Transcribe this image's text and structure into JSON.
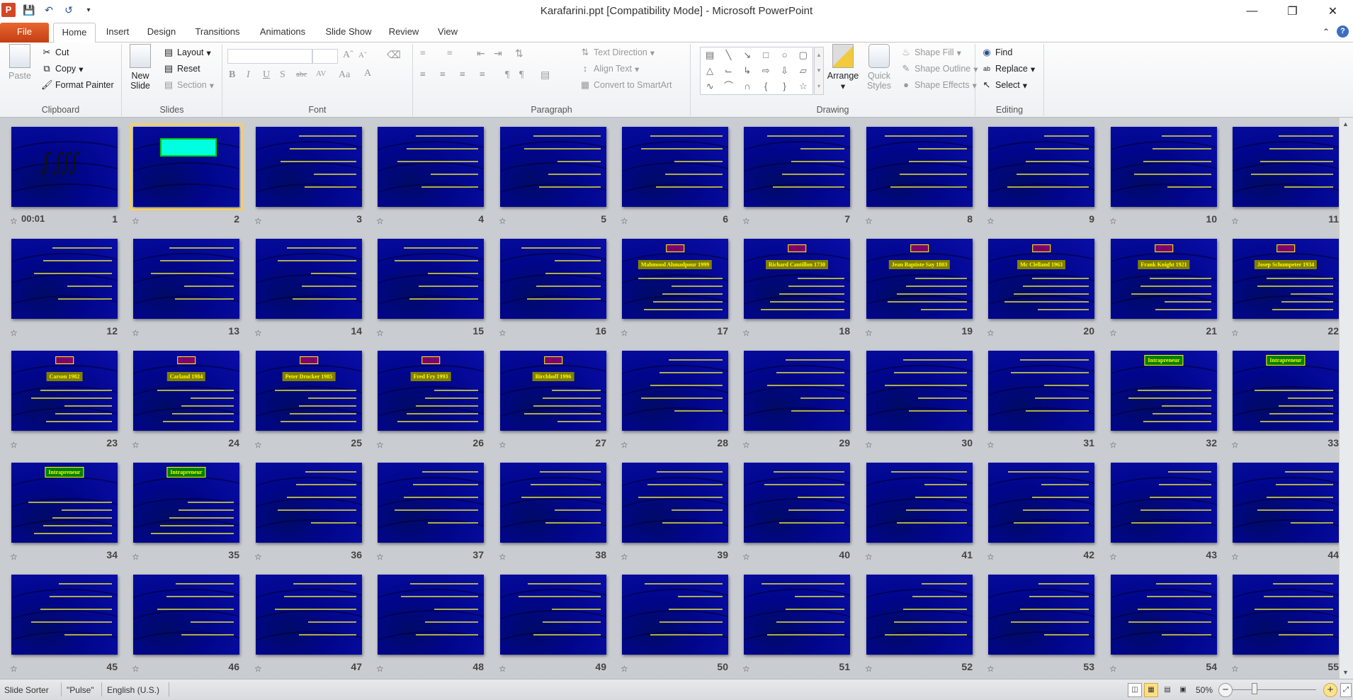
{
  "window": {
    "title": "Karafarini.ppt [Compatibility Mode]  -  Microsoft PowerPoint"
  },
  "tabs": [
    "File",
    "Home",
    "Insert",
    "Design",
    "Transitions",
    "Animations",
    "Slide Show",
    "Review",
    "View"
  ],
  "active_tab": "Home",
  "ribbon": {
    "clipboard": {
      "label": "Clipboard",
      "paste": "Paste",
      "cut": "Cut",
      "copy": "Copy",
      "format_painter": "Format Painter"
    },
    "slides": {
      "label": "Slides",
      "new_slide_1": "New",
      "new_slide_2": "Slide",
      "layout": "Layout",
      "reset": "Reset",
      "section": "Section"
    },
    "font": {
      "label": "Font",
      "font_name": "",
      "font_size": ""
    },
    "paragraph": {
      "label": "Paragraph",
      "text_direction": "Text Direction",
      "align_text": "Align Text",
      "convert_smartart": "Convert to SmartArt"
    },
    "drawing": {
      "label": "Drawing",
      "arrange": "Arrange",
      "quick_styles_1": "Quick",
      "quick_styles_2": "Styles",
      "shape_fill": "Shape Fill",
      "shape_outline": "Shape Outline",
      "shape_effects": "Shape Effects"
    },
    "editing": {
      "label": "Editing",
      "find": "Find",
      "replace": "Replace",
      "select": "Select"
    }
  },
  "sorter": {
    "selected_slide": 2,
    "slide1_timing": "00:01",
    "slides": [
      {
        "n": 1
      },
      {
        "n": 2
      },
      {
        "n": 3
      },
      {
        "n": 4
      },
      {
        "n": 5
      },
      {
        "n": 6
      },
      {
        "n": 7
      },
      {
        "n": 8
      },
      {
        "n": 9
      },
      {
        "n": 10
      },
      {
        "n": 11
      },
      {
        "n": 12
      },
      {
        "n": 13
      },
      {
        "n": 14
      },
      {
        "n": 15
      },
      {
        "n": 16
      },
      {
        "n": 17,
        "name": "Mahmood Ahmadpour 1999"
      },
      {
        "n": 18,
        "name": "Richard Cantillon 1730"
      },
      {
        "n": 19,
        "name": "Jean Baptiste Say 1803"
      },
      {
        "n": 20,
        "name": "Mc Clelland 1963"
      },
      {
        "n": 21,
        "name": "Frank Knight 1921"
      },
      {
        "n": 22,
        "name": "Josep Schumpeter 1934"
      },
      {
        "n": 23,
        "name": "Carson 1982"
      },
      {
        "n": 24,
        "name": "Carland 1984"
      },
      {
        "n": 25,
        "name": "Peter Drucker 1985"
      },
      {
        "n": 26,
        "name": "Fred Fry 1993"
      },
      {
        "n": 27,
        "name": "Birchhoff 1996"
      },
      {
        "n": 28
      },
      {
        "n": 29
      },
      {
        "n": 30
      },
      {
        "n": 31
      },
      {
        "n": 32,
        "name": "Intrapreneur"
      },
      {
        "n": 33,
        "name": "Intrapreneur"
      },
      {
        "n": 34,
        "name": "Intrapreneur"
      },
      {
        "n": 35,
        "name": "Intrapreneur"
      },
      {
        "n": 36
      },
      {
        "n": 37
      },
      {
        "n": 38
      },
      {
        "n": 39
      },
      {
        "n": 40
      },
      {
        "n": 41
      },
      {
        "n": 42
      },
      {
        "n": 43
      },
      {
        "n": 44
      },
      {
        "n": 45
      },
      {
        "n": 46
      },
      {
        "n": 47
      },
      {
        "n": 48
      },
      {
        "n": 49
      },
      {
        "n": 50
      },
      {
        "n": 51
      },
      {
        "n": 52
      },
      {
        "n": 53
      },
      {
        "n": 54
      },
      {
        "n": 55
      }
    ]
  },
  "status": {
    "view": "Slide Sorter",
    "theme": "\"Pulse\"",
    "language": "English (U.S.)",
    "zoom": "50%",
    "zoom_percent": 50
  }
}
